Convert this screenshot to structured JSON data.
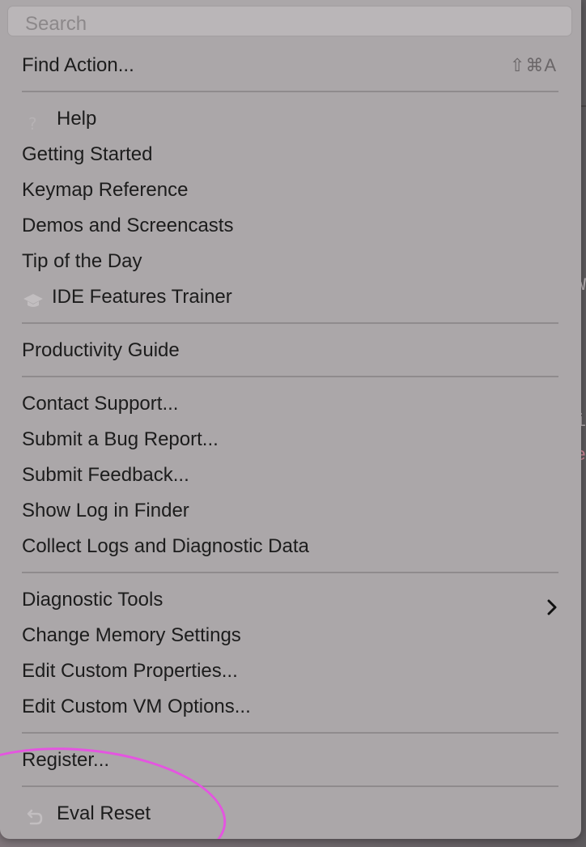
{
  "search": {
    "placeholder": "Search"
  },
  "items": {
    "find_action": {
      "label": "Find Action...",
      "shortcut": "⇧⌘A"
    },
    "help": "Help",
    "getting_started": "Getting Started",
    "keymap_reference": "Keymap Reference",
    "demos": "Demos and Screencasts",
    "tip_of_day": "Tip of the Day",
    "ide_trainer": "IDE Features Trainer",
    "productivity_guide": "Productivity Guide",
    "contact_support": "Contact Support...",
    "submit_bug": "Submit a Bug Report...",
    "submit_feedback": "Submit Feedback...",
    "show_log": "Show Log in Finder",
    "collect_logs": "Collect Logs and Diagnostic Data",
    "diagnostic_tools": "Diagnostic Tools",
    "change_memory": "Change Memory Settings",
    "edit_properties": "Edit Custom Properties...",
    "edit_vm": "Edit Custom VM Options...",
    "register": "Register...",
    "eval_reset": "Eval Reset"
  },
  "icons": {
    "help": "question-mark-icon",
    "ide_trainer": "graduation-cap-icon",
    "diagnostic_tools": "chevron-right-icon",
    "eval_reset": "undo-arrow-icon"
  },
  "colors": {
    "menu_background": "#aba7a9",
    "text": "#1c1c1c",
    "annotation": "#e455e0"
  }
}
